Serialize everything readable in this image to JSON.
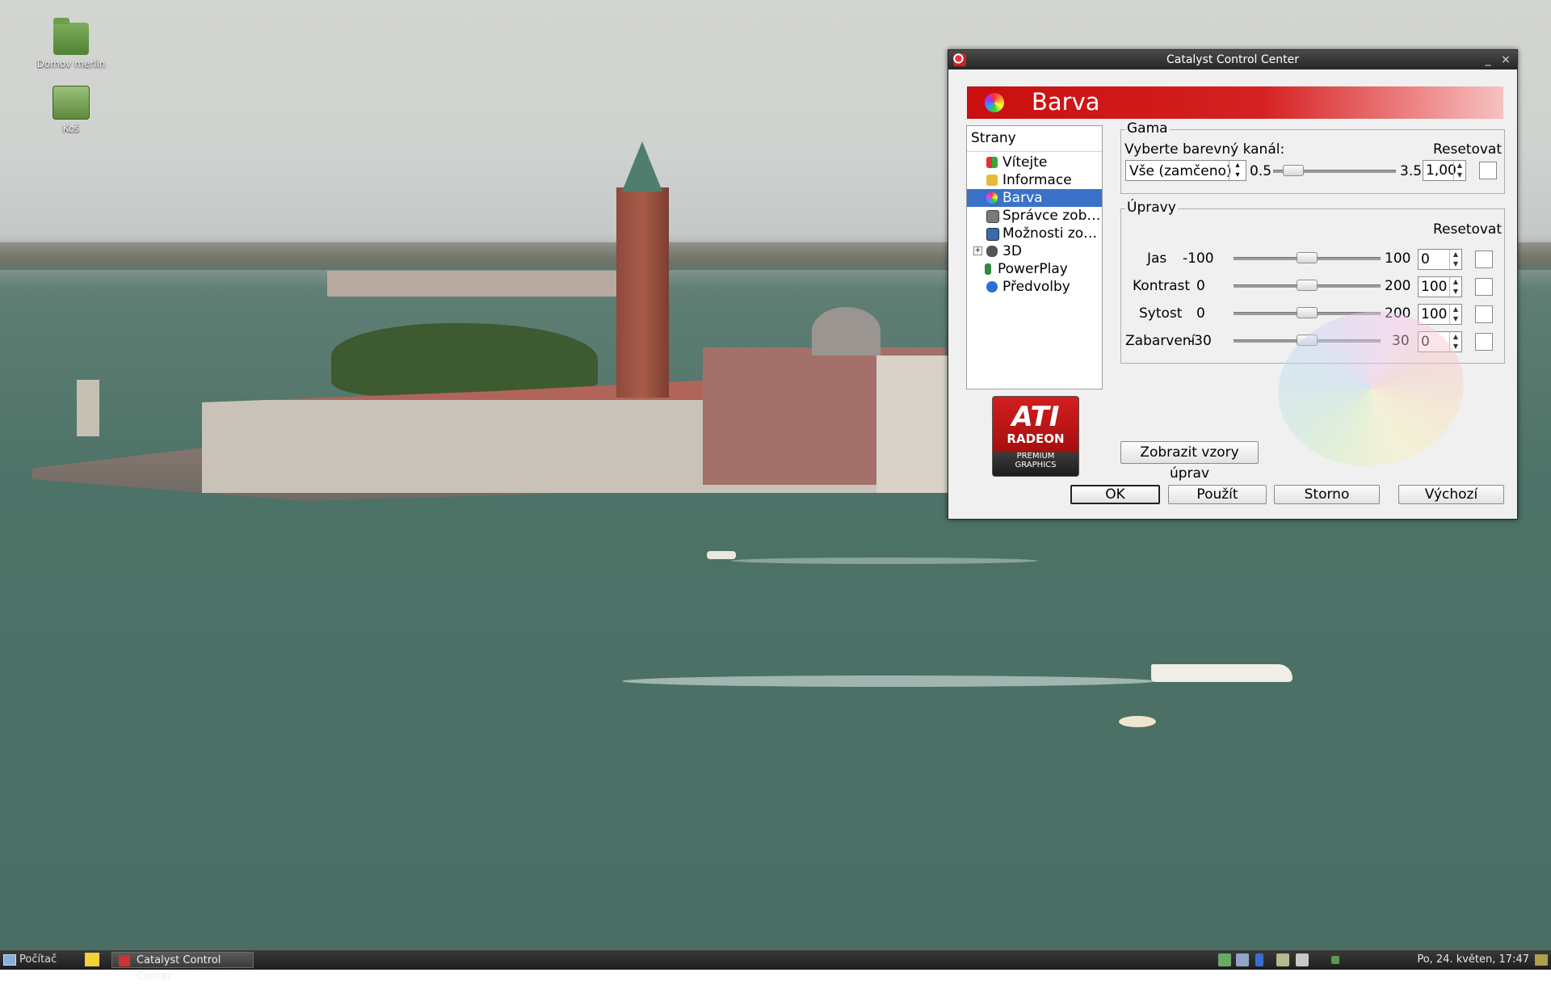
{
  "desktop": {
    "icons": [
      {
        "label": "Domov merlin",
        "icon": "home-folder-icon"
      },
      {
        "label": "Koš",
        "icon": "trash-icon"
      }
    ]
  },
  "window": {
    "title": "Catalyst Control Center",
    "minimize_glyph": "_",
    "close_glyph": "×",
    "page_title": "Barva",
    "nav": {
      "header": "Strany",
      "expand_glyph": "+",
      "items": [
        {
          "label": "Vítejte",
          "icon": "welcome-icon"
        },
        {
          "label": "Informace",
          "icon": "information-icon"
        },
        {
          "label": "Barva",
          "icon": "color-icon",
          "selected": true
        },
        {
          "label": "Správce zob…",
          "icon": "display-manager-icon"
        },
        {
          "label": "Možnosti zo…",
          "icon": "display-options-icon"
        },
        {
          "label": "3D",
          "icon": "3d-icon",
          "expandable": true
        },
        {
          "label": "PowerPlay",
          "icon": "powerplay-icon"
        },
        {
          "label": "Předvolby",
          "icon": "preferences-icon"
        }
      ]
    },
    "logo": {
      "brand": "ATI",
      "line2": "RADEON",
      "line3": "PREMIUM",
      "line4": "GRAPHICS"
    },
    "gamma": {
      "title": "Gama",
      "channel_label": "Vyberte barevný kanál:",
      "reset_label": "Resetovat",
      "channel_value": "Vše (zamčeno)",
      "min": "0.5",
      "max": "3.5",
      "value": "1,00",
      "slider_fraction": 0.167
    },
    "adjust": {
      "title": "Úpravy",
      "reset_label": "Resetovat",
      "rows": [
        {
          "label": "Jas",
          "min": "-100",
          "max": "100",
          "value": "0",
          "slider_fraction": 0.5
        },
        {
          "label": "Kontrast",
          "min": "0",
          "max": "200",
          "value": "100",
          "slider_fraction": 0.5
        },
        {
          "label": "Sytost",
          "min": "0",
          "max": "200",
          "value": "100",
          "slider_fraction": 0.5
        },
        {
          "label": "Zabarvení",
          "min": "-30",
          "max": "30",
          "value": "0",
          "slider_fraction": 0.5
        }
      ]
    },
    "show_patterns_label": "Zobrazit vzory úprav",
    "buttons": {
      "ok": "OK",
      "apply": "Použít",
      "cancel": "Storno",
      "defaults": "Výchozí"
    }
  },
  "taskbar": {
    "start_label": "Počítač",
    "task_label": "Catalyst Control Center",
    "clock": "Po, 24. květen, 17:47",
    "tray_icons": [
      "network-icon",
      "display-icon",
      "bluetooth-icon",
      "monitor-icon",
      "clipboard-icon",
      "workspace-icon"
    ]
  },
  "colors": {
    "accent": "#3a72c9",
    "banner": "#c90f0f",
    "titlebar": "#262626"
  }
}
